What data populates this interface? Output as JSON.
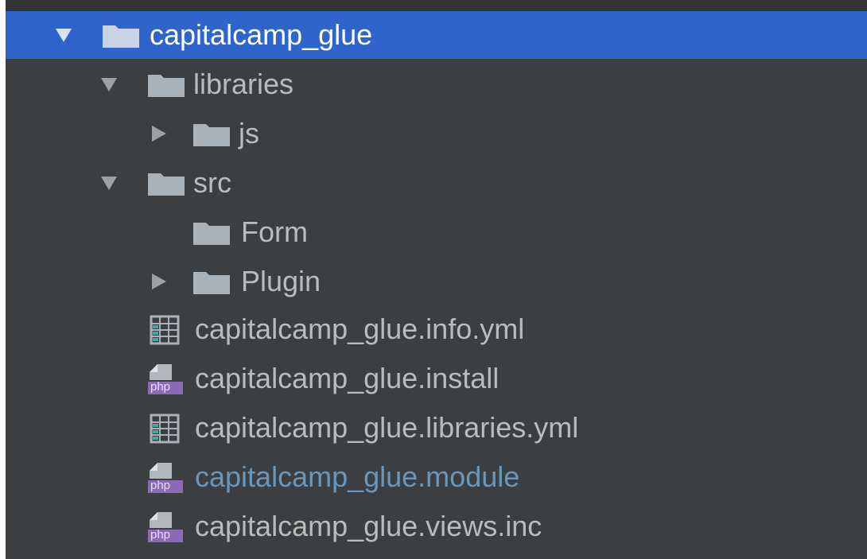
{
  "tree": {
    "root": {
      "label": "capitalcamp_glue",
      "expanded": true,
      "selected": true,
      "icon": "folder-icon"
    },
    "items": [
      {
        "label": "libraries",
        "expanded": true,
        "icon": "folder-icon"
      },
      {
        "label": "js",
        "expanded": false,
        "icon": "folder-icon"
      },
      {
        "label": "src",
        "expanded": true,
        "icon": "folder-icon"
      },
      {
        "label": "Form",
        "icon": "folder-icon"
      },
      {
        "label": "Plugin",
        "expanded": false,
        "icon": "folder-icon"
      },
      {
        "label": "capitalcamp_glue.info.yml",
        "icon": "yml-file-icon"
      },
      {
        "label": "capitalcamp_glue.install",
        "icon": "php-file-icon",
        "badge": "php"
      },
      {
        "label": "capitalcamp_glue.libraries.yml",
        "icon": "yml-file-icon"
      },
      {
        "label": "capitalcamp_glue.module",
        "icon": "php-file-icon",
        "badge": "php",
        "status": "modified"
      },
      {
        "label": "capitalcamp_glue.views.inc",
        "icon": "php-file-icon",
        "badge": "php"
      }
    ]
  },
  "colors": {
    "panel_bg": "#3c3f41",
    "selection_bg": "#2f65ca",
    "text": "#bbbbbb",
    "modified_text": "#6897bb",
    "php_badge": "#8a6bb8"
  }
}
